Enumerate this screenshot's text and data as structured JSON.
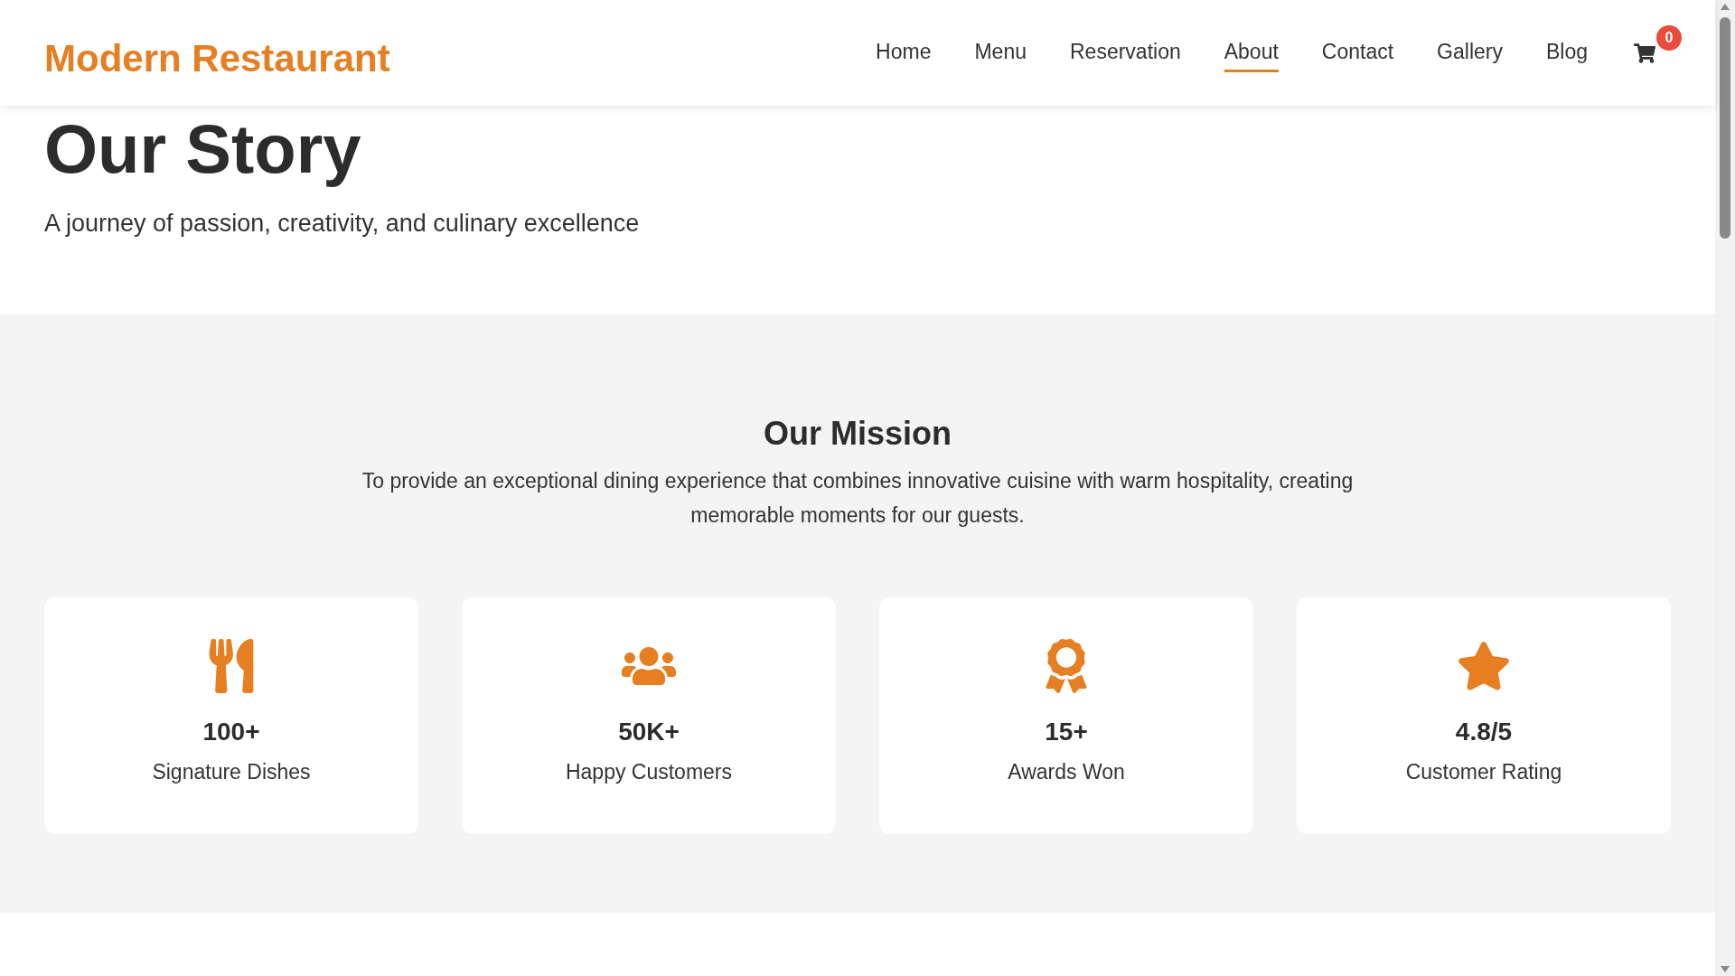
{
  "header": {
    "logo": "Modern Restaurant",
    "nav": [
      {
        "label": "Home",
        "selected": false
      },
      {
        "label": "Menu",
        "selected": false
      },
      {
        "label": "Reservation",
        "selected": false
      },
      {
        "label": "About",
        "selected": true
      },
      {
        "label": "Contact",
        "selected": false
      },
      {
        "label": "Gallery",
        "selected": false
      },
      {
        "label": "Blog",
        "selected": false
      }
    ],
    "cart_count": "0"
  },
  "hero": {
    "title": "Our Story",
    "subtitle": "A journey of passion, creativity, and culinary excellence"
  },
  "mission": {
    "title": "Our Mission",
    "text": "To provide an exceptional dining experience that combines innovative cuisine with warm hospitality, creating memorable moments for our guests.",
    "stats": [
      {
        "kind": "dishes",
        "value": "100+",
        "label": "Signature Dishes"
      },
      {
        "kind": "customers",
        "value": "50K+",
        "label": "Happy Customers"
      },
      {
        "kind": "awards",
        "value": "15+",
        "label": "Awards Won"
      },
      {
        "kind": "rating",
        "value": "4.8/5",
        "label": "Customer Rating"
      }
    ]
  }
}
